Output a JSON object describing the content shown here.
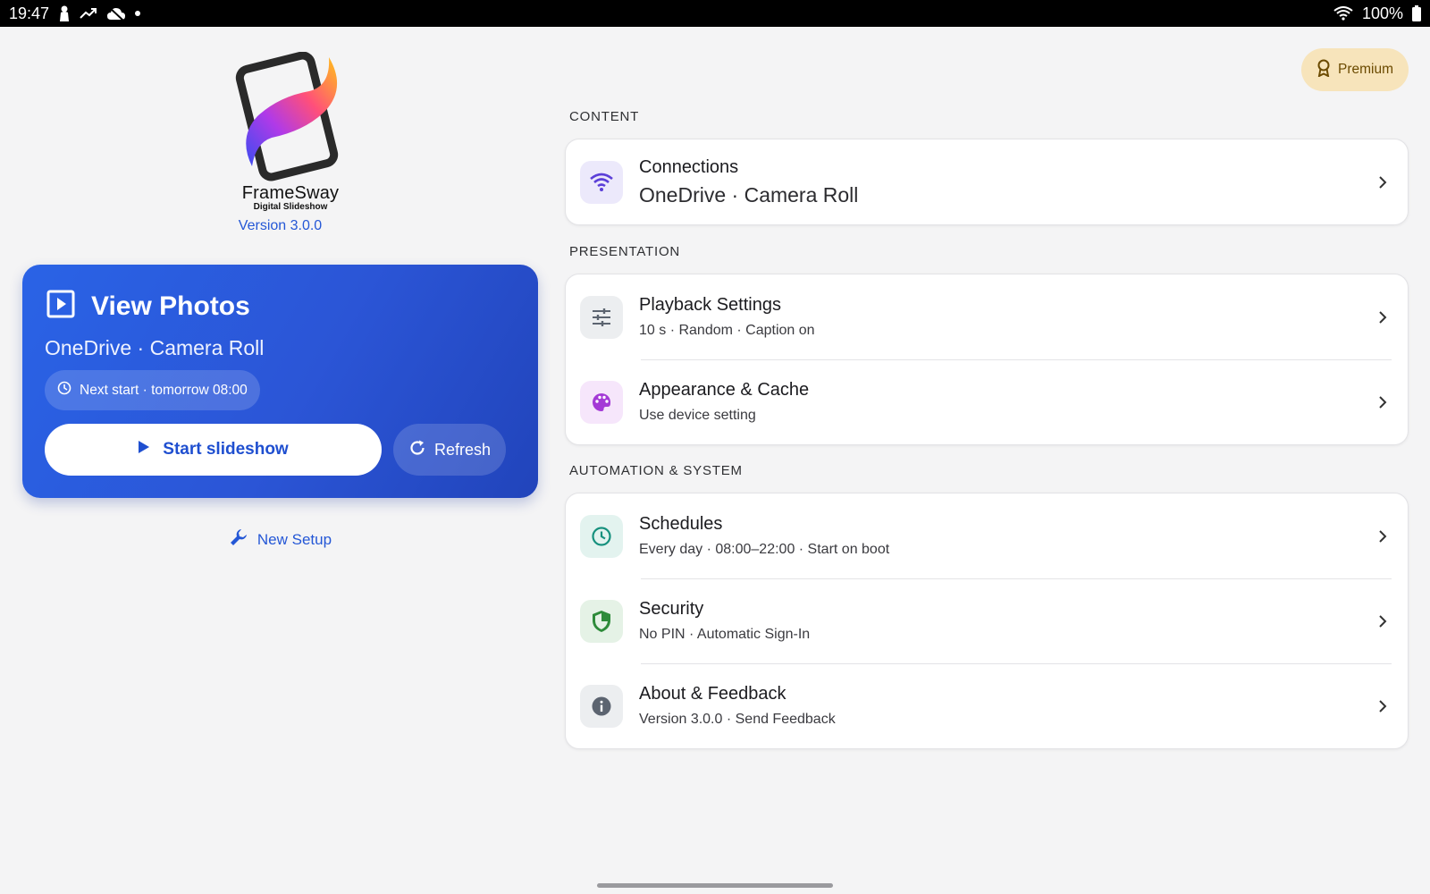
{
  "status_bar": {
    "time": "19:47",
    "battery": "100%"
  },
  "app": {
    "brand_name": "FrameSway",
    "brand_tagline": "Digital Slideshow",
    "version": "Version 3.0.0"
  },
  "hero": {
    "title": "View Photos",
    "source": "OneDrive · Camera Roll",
    "next_start": "Next start · tomorrow 08:00",
    "start_label": "Start slideshow",
    "refresh_label": "Refresh"
  },
  "new_setup_label": "New Setup",
  "premium_label": "Premium",
  "sections": {
    "content": {
      "label": "CONTENT",
      "items": [
        {
          "title": "Connections",
          "subtitle": "OneDrive · Camera Roll"
        }
      ]
    },
    "presentation": {
      "label": "PRESENTATION",
      "items": [
        {
          "title": "Playback Settings",
          "subtitle": "10 s · Random · Caption on"
        },
        {
          "title": "Appearance & Cache",
          "subtitle": "Use device setting"
        }
      ]
    },
    "automation": {
      "label": "AUTOMATION & SYSTEM",
      "items": [
        {
          "title": "Schedules",
          "subtitle": "Every day · 08:00–22:00 · Start on boot"
        },
        {
          "title": "Security",
          "subtitle": "No PIN · Automatic Sign-In"
        },
        {
          "title": "About & Feedback",
          "subtitle": "Version 3.0.0 · Send Feedback"
        }
      ]
    }
  },
  "colors": {
    "accent": "#2457d6",
    "hero_start": "#2a63e6",
    "hero_end": "#2144bb",
    "premium_bg": "#f7e4bb"
  }
}
